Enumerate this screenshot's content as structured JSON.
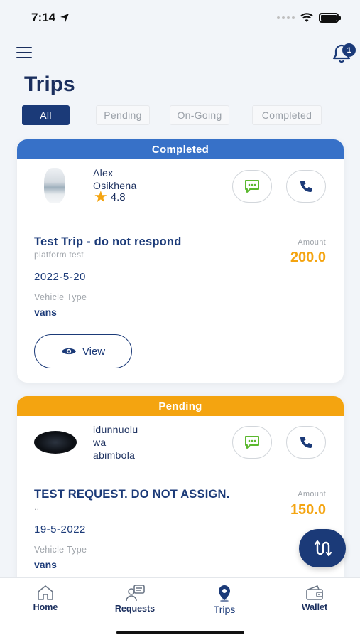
{
  "status_bar": {
    "time": "7:14"
  },
  "header": {
    "notification_count": "1",
    "title": "Trips"
  },
  "filters": [
    {
      "label": "All"
    },
    {
      "label": "Pending"
    },
    {
      "label": "On-Going"
    },
    {
      "label": "Completed"
    }
  ],
  "trips": [
    {
      "status": "Completed",
      "status_color": "#3771c8",
      "driver_lines": [
        "Alex",
        "Osikhena"
      ],
      "rating": "4.8",
      "title": "Test Trip - do not respond",
      "subtitle": "platform test",
      "amount_label": "Amount",
      "amount": "200.0",
      "date": "2022-5-20",
      "vehicle_label": "Vehicle Type",
      "vehicle": "vans",
      "view_label": "View"
    },
    {
      "status": "Pending",
      "status_color": "#f4a410",
      "driver_lines": [
        "idunnuolu",
        "wa",
        "abimbola"
      ],
      "title": "TEST REQUEST. DO NOT ASSIGN.",
      "subtitle": "..",
      "amount_label": "Amount",
      "amount": "150.0",
      "date": "19-5-2022",
      "vehicle_label": "Vehicle Type",
      "vehicle": "vans"
    }
  ],
  "icons": {
    "menu": "hamburger-menu-icon",
    "bell": "bell-icon",
    "chat": "chat-bubble-icon",
    "call": "phone-icon",
    "star": "star-icon",
    "view": "eye-icon",
    "fab": "route-icon"
  },
  "bottom_nav": [
    {
      "label": "Home",
      "icon": "home-icon"
    },
    {
      "label": "Requests",
      "icon": "requests-icon"
    },
    {
      "label": "Trips",
      "icon": "location-pin-icon",
      "active": true
    },
    {
      "label": "Wallet",
      "icon": "wallet-icon"
    }
  ],
  "colors": {
    "primary": "#1b3a78",
    "accent": "#f4a410",
    "completed": "#3771c8",
    "chat_green": "#5bb82e"
  }
}
